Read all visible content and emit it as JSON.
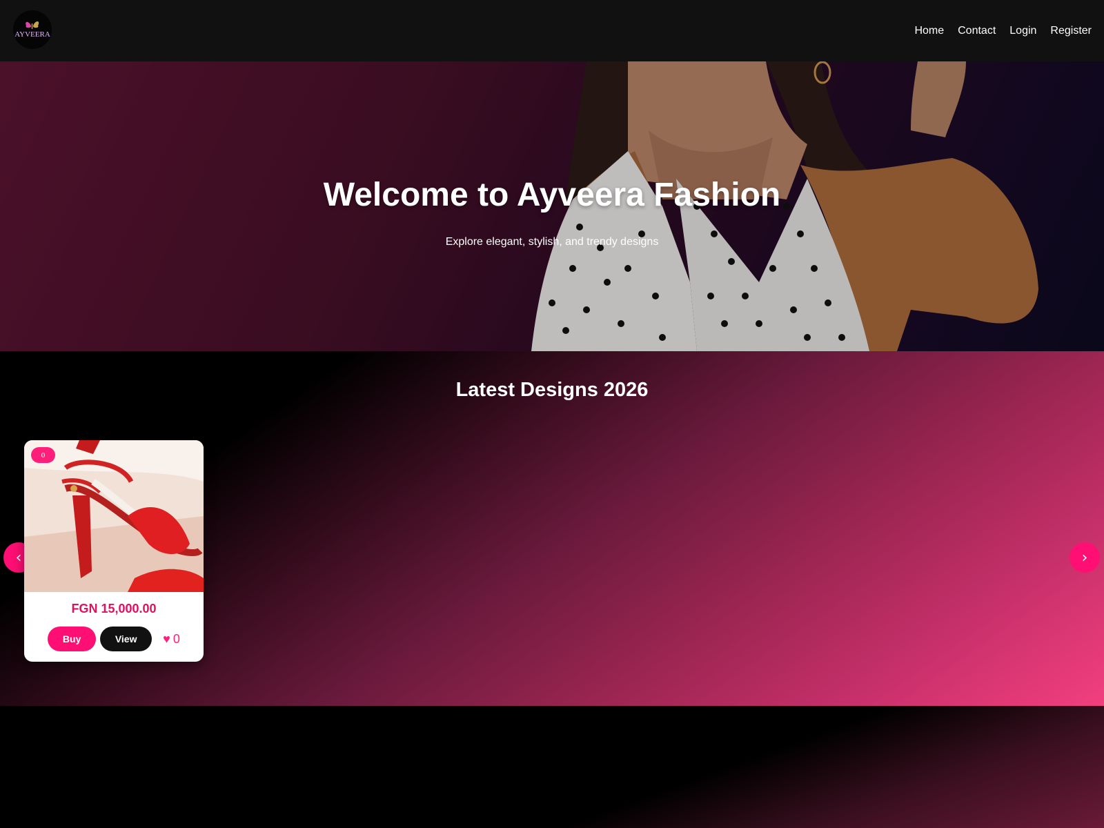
{
  "nav": {
    "logo_text": "AYVEERA",
    "links": [
      "Home",
      "Contact",
      "Login",
      "Register"
    ]
  },
  "hero": {
    "title": "Welcome to Ayveera Fashion",
    "subtitle": "Explore elegant, stylish, and trendy designs"
  },
  "designs": {
    "title": "Latest Designs 2026",
    "prev_arrow": "‹",
    "next_arrow": "›",
    "products": [
      {
        "badge": "0",
        "price": "FGN 15,000.00",
        "buy_label": "Buy",
        "view_label": "View",
        "like_icon": "♥",
        "likes": "0"
      }
    ]
  },
  "colors": {
    "accent": "#ff0f73",
    "price": "#e0115f",
    "navbar": "#111111"
  }
}
